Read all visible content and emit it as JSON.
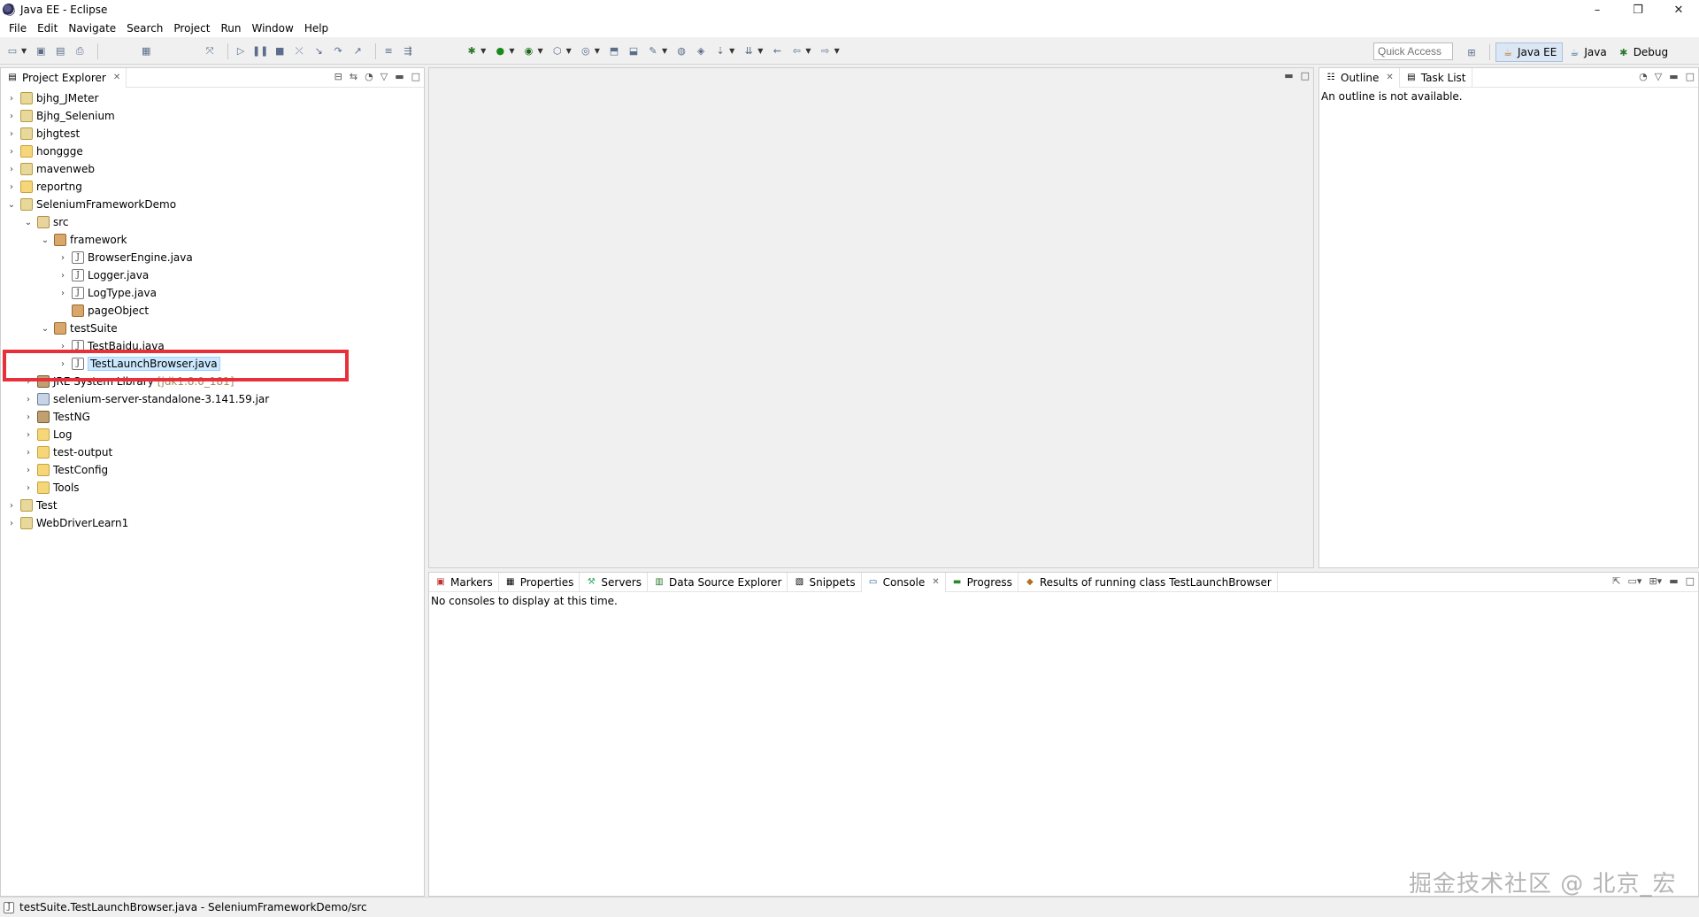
{
  "window": {
    "title": "Java EE - Eclipse",
    "minimize": "–",
    "restore": "❐",
    "close": "✕"
  },
  "menu": [
    "File",
    "Edit",
    "Navigate",
    "Search",
    "Project",
    "Run",
    "Window",
    "Help"
  ],
  "toolbar": {
    "quick_access_placeholder": "Quick Access"
  },
  "perspectives": [
    {
      "label": "Java EE",
      "active": true
    },
    {
      "label": "Java",
      "active": false
    },
    {
      "label": "Debug",
      "active": false
    }
  ],
  "project_explorer": {
    "tab_label": "Project Explorer",
    "items": [
      {
        "label": "bjhg_JMeter"
      },
      {
        "label": "Bjhg_Selenium"
      },
      {
        "label": "bjhgtest"
      },
      {
        "label": "honggge"
      },
      {
        "label": "mavenweb"
      },
      {
        "label": "reportng"
      },
      {
        "label": "SeleniumFrameworkDemo"
      },
      {
        "label": "src"
      },
      {
        "label": "framework"
      },
      {
        "label": "BrowserEngine.java"
      },
      {
        "label": "Logger.java"
      },
      {
        "label": "LogType.java"
      },
      {
        "label": "pageObject"
      },
      {
        "label": "testSuite"
      },
      {
        "label": "TestBaidu.java"
      },
      {
        "label": "TestLaunchBrowser.java"
      },
      {
        "label": "JRE System Library",
        "suffix": "[jdk1.8.0_181]"
      },
      {
        "label": "selenium-server-standalone-3.141.59.jar"
      },
      {
        "label": "TestNG"
      },
      {
        "label": "Log"
      },
      {
        "label": "test-output"
      },
      {
        "label": "TestConfig"
      },
      {
        "label": "Tools"
      },
      {
        "label": "Test"
      },
      {
        "label": "WebDriverLearn1"
      }
    ]
  },
  "outline": {
    "tabs": [
      "Outline",
      "Task List"
    ],
    "message": "An outline is not available."
  },
  "bottom_panel": {
    "tabs": [
      "Markers",
      "Properties",
      "Servers",
      "Data Source Explorer",
      "Snippets",
      "Console",
      "Progress",
      "Results of running class TestLaunchBrowser"
    ],
    "message": "No consoles to display at this time."
  },
  "status": {
    "text": "testSuite.TestLaunchBrowser.java - SeleniumFrameworkDemo/src"
  },
  "watermark": "掘金技术社区 @ 北京_宏哥"
}
